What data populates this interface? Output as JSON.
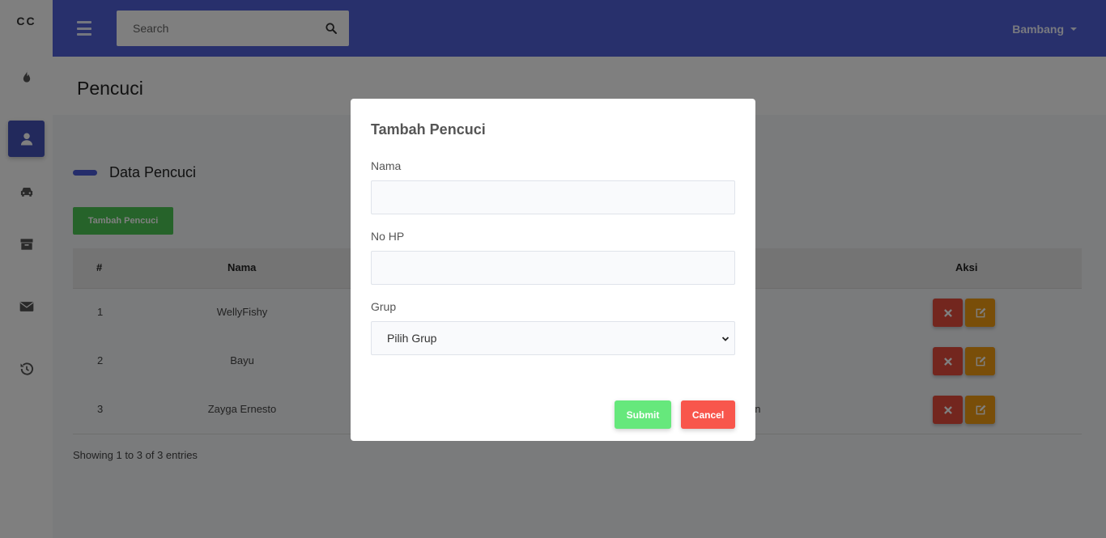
{
  "brand": "CC",
  "topbar": {
    "search_placeholder": "Search",
    "user_name": "Bambang"
  },
  "sidebar": {
    "items": [
      {
        "icon": "fire-icon",
        "active": false
      },
      {
        "icon": "user-icon",
        "active": true
      },
      {
        "icon": "car-icon",
        "active": false
      },
      {
        "icon": "box-icon",
        "active": false
      },
      {
        "icon": "envelope-icon",
        "active": false
      },
      {
        "icon": "history-icon",
        "active": false
      }
    ]
  },
  "page": {
    "title": "Pencuci",
    "section_title": "Data Pencuci",
    "add_button": "Tambah Pencuci"
  },
  "table": {
    "headers": {
      "no": "#",
      "nama": "Nama",
      "aksi": "Aksi"
    },
    "rows": [
      {
        "no": "1",
        "nama": "WellyFishy",
        "partial": ""
      },
      {
        "no": "2",
        "nama": "Bayu",
        "partial": ""
      },
      {
        "no": "3",
        "nama": "Zayga Ernesto",
        "partial": "on"
      }
    ],
    "footer": "Showing 1 to 3 of 3 entries"
  },
  "modal": {
    "title": "Tambah Pencuci",
    "nama_label": "Nama",
    "nama_value": "",
    "hp_label": "No HP",
    "hp_value": "",
    "grup_label": "Grup",
    "grup_selected": "Pilih Grup",
    "submit_label": "Submit",
    "cancel_label": "Cancel"
  },
  "colors": {
    "primary": "#5060d8",
    "success": "#4cc754",
    "danger": "#e74c3c",
    "warning": "#f39c12"
  }
}
